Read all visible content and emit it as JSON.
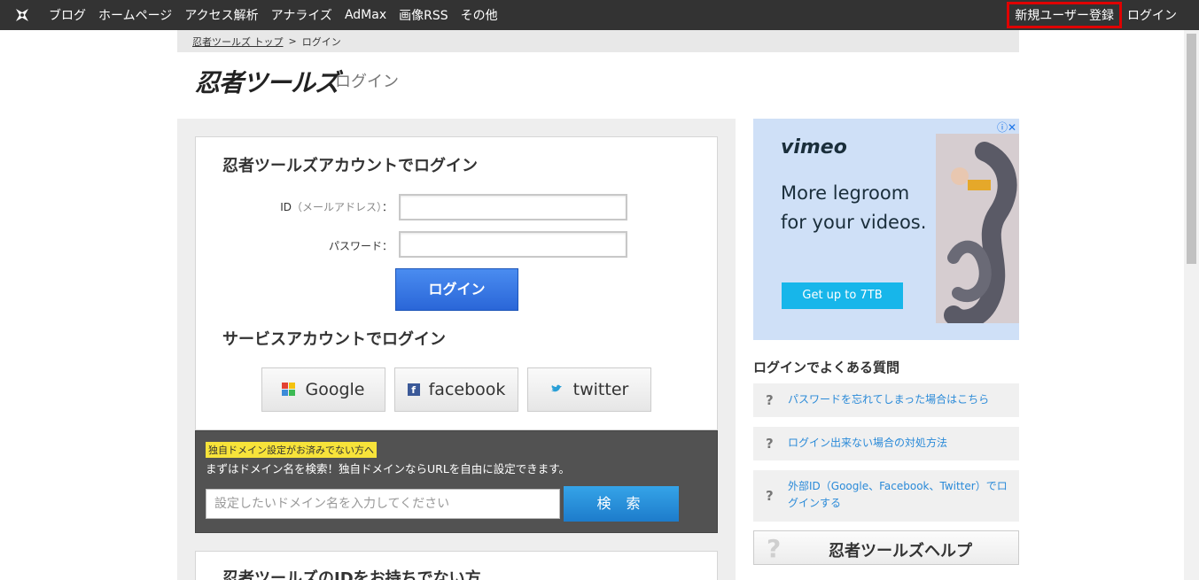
{
  "topbar": {
    "nav": [
      "ブログ",
      "ホームページ",
      "アクセス解析",
      "アナライズ",
      "AdMax",
      "画像RSS",
      "その他"
    ],
    "register": "新規ユーザー登録",
    "login": "ログイン"
  },
  "breadcrumb": {
    "home": "忍者ツールズ トップ",
    "separator": ">",
    "current": "ログイン"
  },
  "header": {
    "logo": "忍者ツールズ",
    "title": "ログイン"
  },
  "login": {
    "title": "忍者ツールズアカウントでログイン",
    "id_label": "ID",
    "id_hint": "（メールアドレス）",
    "id_colon": "：",
    "password_label": "パスワード：",
    "id_value": "",
    "password_value": "",
    "submit": "ログイン"
  },
  "service": {
    "title": "サービスアカウントでログイン",
    "buttons": [
      "Google",
      "facebook",
      "twitter"
    ]
  },
  "domain": {
    "badge": "独自ドメイン設定がお済みでない方へ",
    "description": "まずはドメイン名を検索！独自ドメインならURLを自由に設定できます。",
    "placeholder": "設定したいドメイン名を入力してください",
    "button": "検 索"
  },
  "noid": {
    "title": "忍者ツールズのIDをお持ちでない方"
  },
  "ad": {
    "brand": "vimeo",
    "copy": "More legroom for your videos.",
    "cta": "Get up to 7TB",
    "info_icon": "ⓘ✕"
  },
  "faq": {
    "title": "ログインでよくある質問",
    "items": [
      "パスワードを忘れてしまった場合はこちら",
      "ログイン出来ない場合の対処方法",
      "外部ID（Google、Facebook、Twitter）でログインする"
    ]
  },
  "help": {
    "label": "忍者ツールズヘルプ"
  },
  "colors": {
    "topbar": "#333333",
    "register_border": "#e00000",
    "login_button": "#2a66d8",
    "link": "#2a8ad8"
  }
}
